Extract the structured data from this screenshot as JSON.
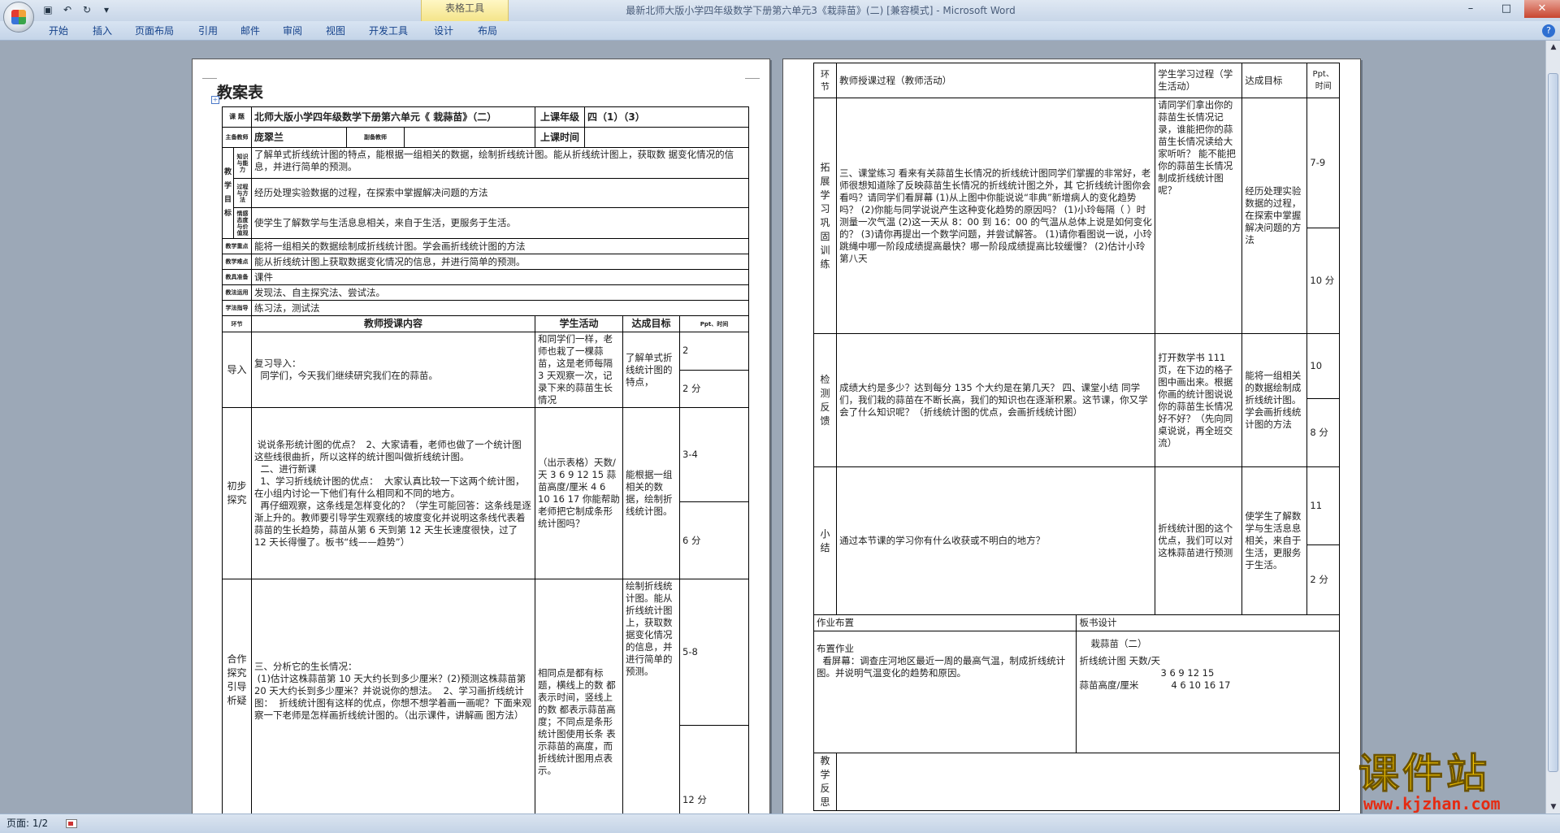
{
  "window": {
    "title": "最新北师大版小学四年级数学下册第六单元3《栽蒜苗》(二) [兼容模式] - Microsoft Word",
    "contextual_tab_group": "表格工具"
  },
  "ribbon": {
    "tabs": [
      "开始",
      "插入",
      "页面布局",
      "引用",
      "邮件",
      "审阅",
      "视图",
      "开发工具",
      "设计",
      "布局"
    ]
  },
  "status": {
    "page": "页面: 1/2"
  },
  "page1": {
    "heading": "教案表",
    "info": {
      "subject_label": "课 题",
      "subject": "北师大版小学四年级数学下册第六单元《 栽蒜苗》（二）",
      "grade_label": "上课年级",
      "grade": "四（1）（3）",
      "teacher_label": "主备教师",
      "teacher": "庞翠兰",
      "assistant_label": "副备教师",
      "time_label": "上课时间"
    },
    "goals": {
      "group_label": "教学目标",
      "rows": [
        {
          "label": "知识与能力",
          "text": "了解单式折线统计图的特点，能根据一组相关的数据，绘制折线统计图。能从折线统计图上，获取数 据变化情况的信息，并进行简单的预测。"
        },
        {
          "label": "过程与方法",
          "text": "经历处理实验数据的过程，在探索中掌握解决问题的方法"
        },
        {
          "label": "情感态度与价值观",
          "text": "使学生了解数学与生活息息相关，来自于生活，更服务于生活。"
        }
      ]
    },
    "meta_rows": [
      {
        "label": "教学重点",
        "text": "能将一组相关的数据绘制成折线统计图。学会画折线统计图的方法"
      },
      {
        "label": "教学难点",
        "text": "能从折线统计图上获取数据变化情况的信息，并进行简单的预测。"
      },
      {
        "label": "教具准备",
        "text": "课件"
      },
      {
        "label": "教法运用",
        "text": "发现法、自主探究法、尝试法。"
      },
      {
        "label": "学法指导",
        "text": "练习法，测试法"
      }
    ],
    "process_header": {
      "step": "环节",
      "teacher": "教师授课内容",
      "student": "学生活动",
      "goal": "达成目标",
      "ppt": "Ppt、时间"
    },
    "process_rows": [
      {
        "step": "导入",
        "teacher": "复习导入：\n  同学们，今天我们继续研究我们在的蒜苗。",
        "student": "和同学们一样，老师也栽了一棵蒜苗，这是老师每隔 3 天观察一次，记录下来的蒜苗生长情况",
        "goal": "了解单式折线统计图的特点，",
        "ppt": [
          "2",
          "2 分"
        ]
      },
      {
        "step": "初步探究",
        "teacher": " 说说条形统计图的优点？  2、大家请看，老师也做了一个统计图 这些线很曲折，所以这样的统计图叫做折线统计图。\n  二、进行新课\n  1、学习折线统计图的优点：  大家认真比较一下这两个统计图，在小组内讨论一下他们有什么相同和不同的地方。\n  再仔细观察，这条线是怎样变化的？（学生可能回答：这条线是逐渐上升的。教师要引导学生观察线的坡度变化并说明这条线代表着蒜苗的生长趋势，蒜苗从第 6 天到第 12 天生长速度很快，过了 12 天长得慢了。板书“线——趋势”）",
        "student": "（出示表格）天数/天 3 6 9 12 15  蒜苗高度/厘米 4 6 10 16 17  你能帮助老师把它制成条形统计图吗？",
        "goal": "能根据一组相关的数据，绘制折线统计图。",
        "ppt": [
          "3-4",
          "6 分"
        ]
      },
      {
        "step": "合作探究引导析疑",
        "teacher": "三、分析它的生长情况：\n (1)估计这株蒜苗第 10 天大约长到多少厘米？(2)预测这株蒜苗第 20 天大约长到多少厘米？并说说你的想法。  2、学习画折线统计图：  折线统计图有这样的优点，你想不想学着画一画呢？下面来观察一下老师是怎样画折线统计图的。（出示课件，讲解画 图方法）",
        "student": "  相同点是都有标题，横线上的数 都表示时间，竖线上的数 都表示蒜苗高度；不同点是条形统计图使用长条 表示蒜苗的高度，而折线统计图用点表示。",
        "goal": "绘制折线统计图。能从折线统计图上，获取数据变化情况的信息，并进行简单的预测。",
        "ppt": [
          "5-8",
          "12 分"
        ]
      }
    ]
  },
  "page2": {
    "header": {
      "step": "环节",
      "teacher": "教师授课过程（教师活动）",
      "student": "学生学习过程（学生活动）",
      "goal": "达成目标",
      "ppt": "Ppt、时间"
    },
    "rows": [
      {
        "step": "拓展学习巩固训练",
        "teacher": "三、课堂练习  看来有关蒜苗生长情况的折线统计图同学们掌握的非常好，老师很想知道除了反映蒜苗生长情况的折线统计图之外，其  它折线统计图你会看吗？请同学们看屏幕  (1)从上图中你能说说“非典”新增病人的变化趋势吗？  (2)你能与同学说说产生这种变化趋势的原因吗？  (1)小玲每隔（ ）时测量一次气温  (2)这一天从 8：00 到 16：00 的气温从总体上说是如何变化的？  (3)请你再提出一个数学问题，并尝试解答。  (1)请你看图说一说，小玲跳绳中哪一阶段成绩提高最快？哪一阶段成绩提高比较缓慢？  (2)估计小玲第八天",
        "student": "请同学们拿出你的蒜苗生长情况记录，谁能把你的蒜苗生长情况读给大家听听？  能不能把你的蒜苗生长情况制成折线统计图呢？",
        "goal": "经历处理实验数据的过程，在探索中掌握解决问题的方法",
        "ppt": [
          "7-9",
          "10 分"
        ]
      },
      {
        "step": "检测反馈",
        "teacher": "成绩大约是多少？达到每分 135 个大约是在第几天？  四、课堂小结  同学们，我们栽的蒜苗在不断长高，我们的知识也在逐渐积累。这节课，你又学会了什么知识呢？（折线统计图的优点，会画折线统计图）",
        "student": "  打开数学书 111 页，在下边的格子图中画出来。根据你画的统计图说说你的蒜苗生长情况好不好？（先向同桌说说，再全班交流）",
        "goal": "能将一组相关的数据绘制成折线统计图。学会画折线统计图的方法",
        "ppt": [
          "10",
          "8 分"
        ]
      },
      {
        "step": "小结",
        "teacher": "通过本节课的学习你有什么收获或不明白的地方？",
        "student": "折线统计图的这个优点，我们可以对这株蒜苗进行预测",
        "goal": "使学生了解数学与生活息息相关，来自于生活，更服务于生活。",
        "ppt": [
          "11",
          "2 分"
        ]
      }
    ],
    "homework": {
      "label": "作业布置",
      "text": "布置作业\n  看屏幕：调查庄河地区最近一周的最高气温，制成折线统计图。并说明气温变化的趋势和原因。"
    },
    "board": {
      "label": "板书设计",
      "title": "栽蒜苗（二）",
      "line1": "折线统计图 天数/天",
      "days": "3 6 9 12 15",
      "line2": "蒜苗高度/厘米",
      "heights": "4 6 10 16 17"
    },
    "reflection_label": "教学反思"
  },
  "watermark": {
    "text": "课件站",
    "url": "www.kjzhan.com"
  }
}
